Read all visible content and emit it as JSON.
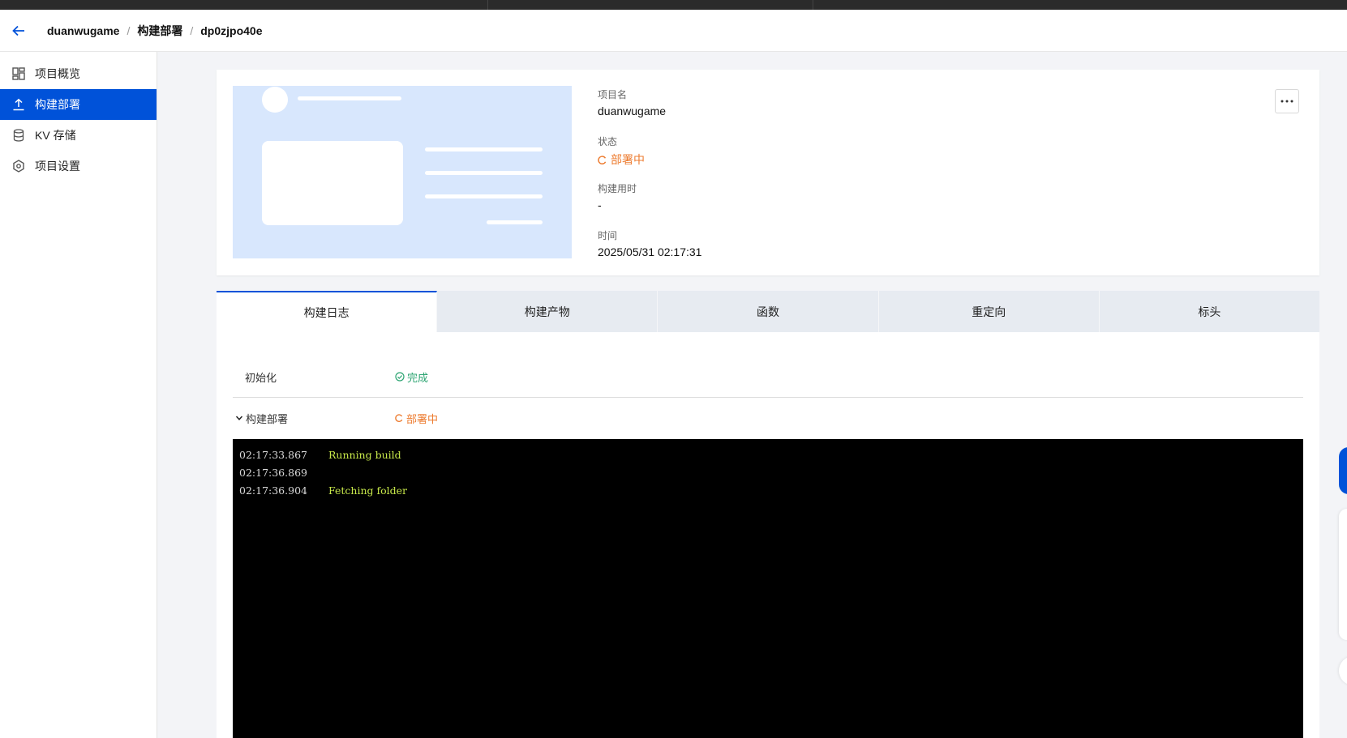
{
  "breadcrumb": {
    "project": "duanwugame",
    "section": "构建部署",
    "deployment": "dp0zjpo40e"
  },
  "sidebar": {
    "items": [
      {
        "label": "项目概览",
        "icon": "dashboard-icon"
      },
      {
        "label": "构建部署",
        "icon": "upload-icon",
        "active": true
      },
      {
        "label": "KV 存储",
        "icon": "database-icon"
      },
      {
        "label": "项目设置",
        "icon": "settings-icon"
      }
    ]
  },
  "deployment": {
    "project_label": "项目名",
    "project_value": "duanwugame",
    "status_label": "状态",
    "status_value": "部署中",
    "build_time_label": "构建用时",
    "build_time_value": "-",
    "time_label": "时间",
    "time_value": "2025/05/31 02:17:31"
  },
  "tabs": [
    "构建日志",
    "构建产物",
    "函数",
    "重定向",
    "标头"
  ],
  "steps": [
    {
      "name": "初始化",
      "status": "完成"
    },
    {
      "name": "构建部署",
      "status": "部署中"
    }
  ],
  "logs": [
    {
      "time": "02:17:33.867",
      "message": "Running build"
    },
    {
      "time": "02:17:36.869",
      "message": ""
    },
    {
      "time": "02:17:36.904",
      "message": "Fetching folder"
    }
  ],
  "colors": {
    "primary": "#0052d9",
    "running": "#ed7b2f",
    "success": "#2ba471",
    "log_message": "#c7e84a"
  }
}
